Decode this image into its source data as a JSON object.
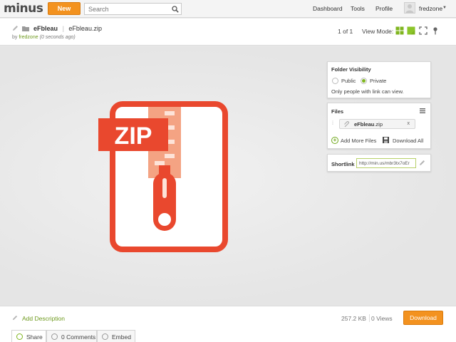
{
  "topbar": {
    "logo": "minus",
    "new_label": "New",
    "search_placeholder": "Search",
    "nav": [
      "Dashboard",
      "Tools",
      "Profile"
    ],
    "username": "fredzone"
  },
  "header": {
    "folder_name": "eFbleau",
    "file_name": "eFbleau.zip",
    "by_prefix": "by",
    "by_user": "fredzone",
    "time_ago": "(0 seconds ago)",
    "pager": "1 of 1",
    "view_mode_label": "View Mode:"
  },
  "preview": {
    "badge_text": "ZIP",
    "colors": {
      "accent": "#e9482e",
      "zipper": "#f4a383"
    }
  },
  "visibility": {
    "title": "Folder Visibility",
    "public_label": "Public",
    "private_label": "Private",
    "selected": "Private",
    "note": "Only people with link can view."
  },
  "files": {
    "title": "Files",
    "items": [
      {
        "name": "eFbleau",
        "ext": ".zip",
        "remove": "x"
      }
    ],
    "add_more_label": "Add More Files",
    "download_all_label": "Download All"
  },
  "shortlink": {
    "label": "Shortlink",
    "value": "http://min.us/mbr3tx7oEr"
  },
  "bottom": {
    "add_description": "Add Description",
    "file_size": "257.2 KB",
    "views": "0 Views",
    "download_label": "Download",
    "tabs": [
      "Share",
      "0 Comments",
      "Embed"
    ]
  },
  "colors": {
    "brand_orange": "#f3921f",
    "accent_green": "#7fb51f",
    "link_green": "#6e9a1e"
  }
}
